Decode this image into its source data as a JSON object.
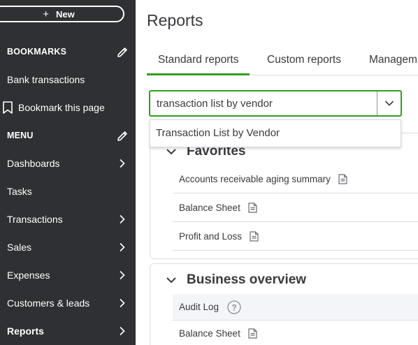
{
  "sidebar": {
    "new_label": "New",
    "bookmarks_heading": "BOOKMARKS",
    "bookmark_items": [
      "Bank transactions",
      "Bookmark this page"
    ],
    "menu_heading": "MENU",
    "menu_items": [
      "Dashboards",
      "Tasks",
      "Transactions",
      "Sales",
      "Expenses",
      "Customers & leads",
      "Reports"
    ],
    "icons": {
      "edit": "pencil-icon",
      "bookmark": "bookmark-icon",
      "chevron": "chevron-right-icon"
    }
  },
  "main": {
    "title": "Reports",
    "tabs": [
      "Standard reports",
      "Custom reports",
      "Managem"
    ],
    "search": {
      "value": "transaction list by vendor"
    },
    "dropdown": {
      "items": [
        "Transaction List by Vendor"
      ]
    },
    "favorites": {
      "title": "Favorites",
      "reports": [
        "Accounts receivable aging summary",
        "Balance Sheet",
        "Profit and Loss"
      ]
    },
    "business_overview": {
      "title": "Business overview",
      "reports": [
        "Audit Log",
        "Balance Sheet"
      ]
    }
  },
  "colors": {
    "sidebar_bg": "#2f3033",
    "accent_green": "#2ca01c",
    "text": "#393a3d"
  }
}
